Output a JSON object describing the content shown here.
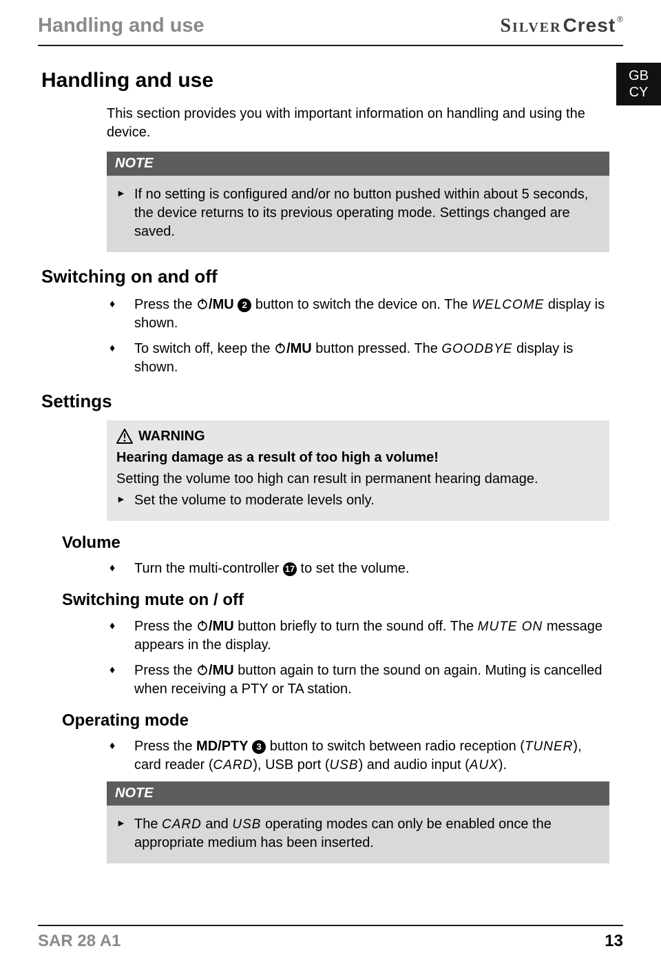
{
  "header": {
    "running_title": "Handling and use",
    "brand_silver": "Silver",
    "brand_crest": "Crest",
    "brand_reg": "®"
  },
  "locale_chip": {
    "line1": "GB",
    "line2": "CY"
  },
  "h1": "Handling and use",
  "intro": "This section provides you with important information on handling and using the device.",
  "note1": {
    "label": "NOTE",
    "text": "If no setting is configured and/or no button pushed within about 5 seconds, the device returns to its previous operating mode. Settings changed are saved."
  },
  "switch": {
    "heading": "Switching on and off",
    "on_pre": "Press the ",
    "on_mu": "/MU",
    "on_badge": "2",
    "on_post": " button to switch the device on. The ",
    "on_display": "WELCOME",
    "on_tail": " display is shown.",
    "off_pre": "To switch off, keep the ",
    "off_mu": "/MU",
    "off_post": " button pressed. The ",
    "off_display": "GOODBYE",
    "off_tail": " display is shown."
  },
  "settings": {
    "heading": "Settings"
  },
  "warning": {
    "label": "WARNING",
    "bold": "Hearing damage as a result of too high a volume!",
    "text": "Setting the volume too high can result in permanent hearing damage.",
    "bullet": "Set the volume to moderate levels only."
  },
  "volume": {
    "heading": "Volume",
    "pre": "Turn the multi-controller ",
    "badge": "17",
    "post": " to set the volume."
  },
  "mute": {
    "heading": "Switching mute on / off",
    "i1_pre": "Press the ",
    "i1_mu": "/MU",
    "i1_mid": " button briefly to turn the sound off. The ",
    "i1_disp": "MUTE ON",
    "i1_tail": " message appears in the display.",
    "i2_pre": "Press the ",
    "i2_mu": "/MU",
    "i2_tail": " button again to turn the sound on again. Muting is cancelled when receiving a PTY or TA station."
  },
  "opmode": {
    "heading": "Operating mode",
    "pre": "Press the ",
    "md": "MD/PTY",
    "badge": "3",
    "mid1": " button to switch between radio reception (",
    "d1": "TUNER",
    "mid2": "), card reader (",
    "d2": "CARD",
    "mid3": "), USB port (",
    "d3": "USB",
    "mid4": ") and audio input (",
    "d4": "AUX",
    "tail": ")."
  },
  "note2": {
    "label": "NOTE",
    "pre": "The ",
    "d1": "CARD",
    "mid": " and ",
    "d2": "USB",
    "tail": " operating modes can only be enabled once the appropriate medium has been inserted."
  },
  "footer": {
    "model": "SAR 28 A1",
    "page": "13"
  }
}
